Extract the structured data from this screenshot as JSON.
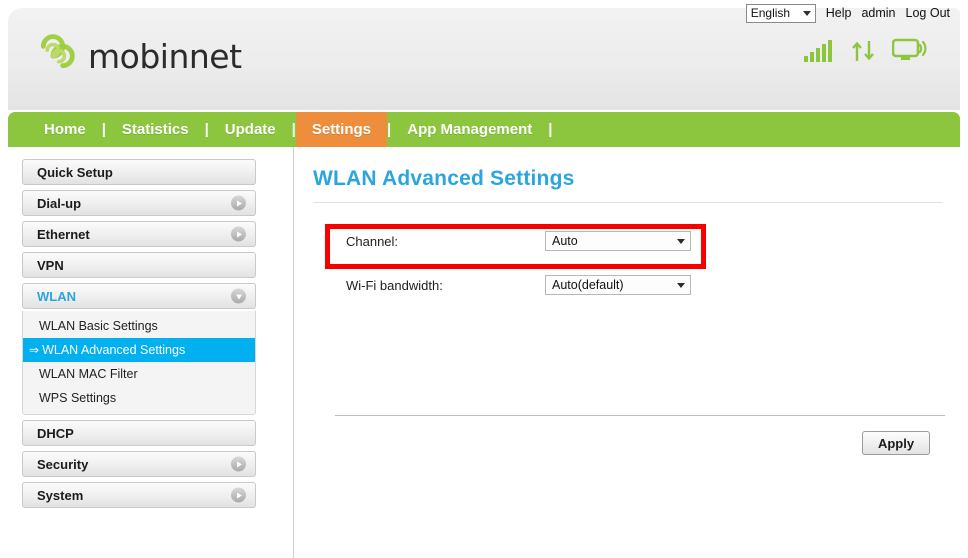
{
  "topbar": {
    "language": {
      "value": "English",
      "icon": "chevron-down-icon"
    },
    "help_label": "Help",
    "user_label": "admin",
    "logout_label": "Log Out"
  },
  "header": {
    "brand_name": "mobinnet",
    "brand_color": "#8cc63e",
    "logo_icon": "mobinnet-swirl-logo",
    "status_icons": [
      "signal-bars-icon",
      "up-down-arrows-icon",
      "monitor-wifi-icon"
    ]
  },
  "nav": {
    "active": "Settings",
    "active_color": "#ee8e3d",
    "bar_color": "#8cc63e",
    "items": [
      {
        "label": "Home",
        "active": false
      },
      {
        "label": "Statistics",
        "active": false
      },
      {
        "label": "Update",
        "active": false
      },
      {
        "label": "Settings",
        "active": true
      },
      {
        "label": "App Management",
        "active": false
      }
    ],
    "separator": "|"
  },
  "sidebar": {
    "items": [
      {
        "label": "Quick Setup",
        "chevron": "none"
      },
      {
        "label": "Dial-up",
        "chevron": "right"
      },
      {
        "label": "Ethernet",
        "chevron": "right"
      },
      {
        "label": "VPN",
        "chevron": "none"
      },
      {
        "label": "WLAN",
        "chevron": "down",
        "expanded": true
      },
      {
        "label": "DHCP",
        "chevron": "none"
      },
      {
        "label": "Security",
        "chevron": "right"
      },
      {
        "label": "System",
        "chevron": "right"
      }
    ],
    "wlan_submenu": [
      {
        "label": "WLAN Basic Settings",
        "selected": false
      },
      {
        "label": "WLAN Advanced Settings",
        "selected": true,
        "arrow": "⇒"
      },
      {
        "label": "WLAN MAC Filter",
        "selected": false
      },
      {
        "label": "WPS Settings",
        "selected": false
      }
    ],
    "selected_color": "#00b0ef",
    "open_text_color": "#2ba6dd"
  },
  "main": {
    "title": "WLAN Advanced Settings",
    "title_color": "#2ba6dd",
    "fields": [
      {
        "label": "Channel:",
        "value": "Auto",
        "highlighted": true
      },
      {
        "label": "Wi-Fi bandwidth:",
        "value": "Auto(default)",
        "highlighted": false
      }
    ],
    "highlight_color": "#f90000",
    "apply_label": "Apply"
  }
}
